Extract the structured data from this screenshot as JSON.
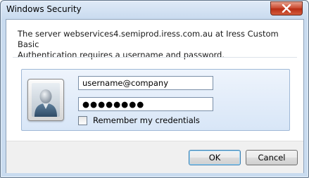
{
  "window": {
    "title": "Windows Security"
  },
  "dialog": {
    "message_line1": "The server webservices4.semiprod.iress.com.au at Iress Custom Basic",
    "message_line2": "Authentication requires a username and password."
  },
  "form": {
    "username_value": "username@company",
    "password_mask": "●●●●●●●●",
    "remember_label": "Remember my credentials",
    "remember_checked": false
  },
  "buttons": {
    "ok": "OK",
    "cancel": "Cancel"
  },
  "icons": {
    "close": "close-icon",
    "user": "user-avatar-icon"
  }
}
